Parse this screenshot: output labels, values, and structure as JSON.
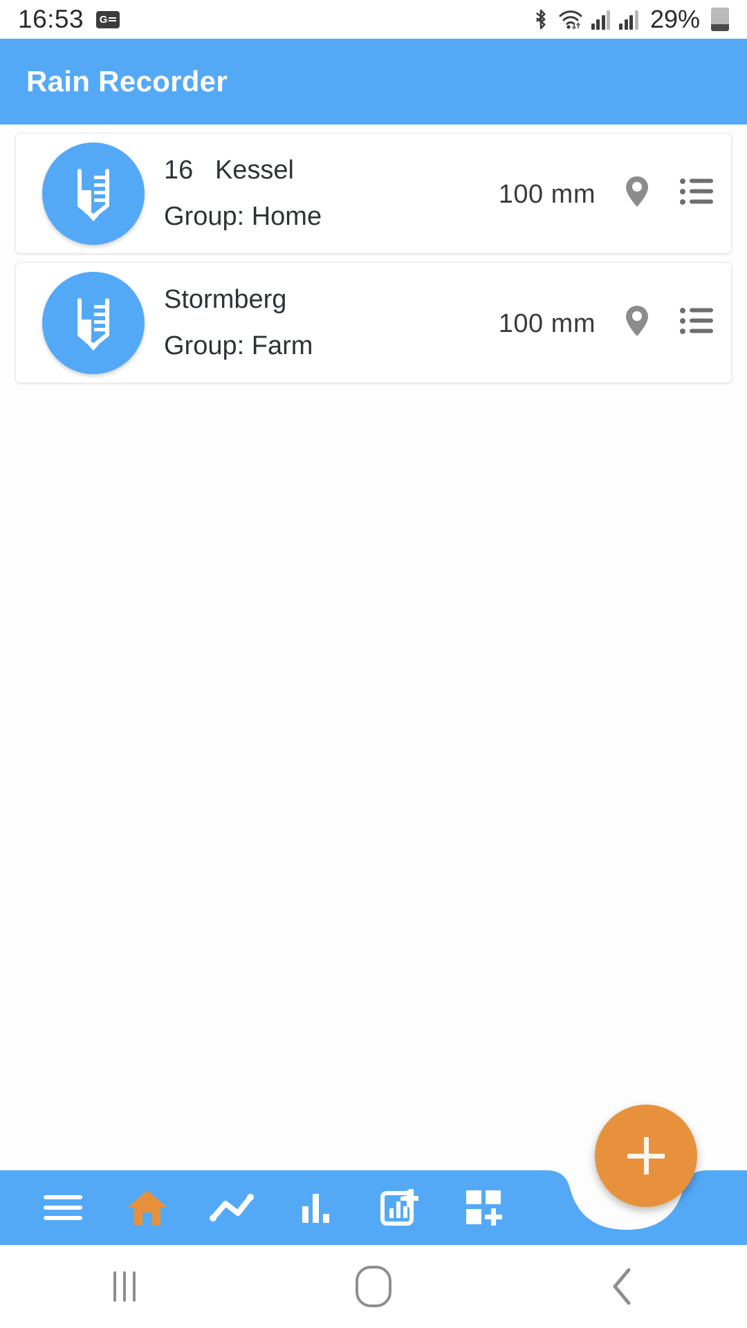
{
  "status_bar": {
    "time": "16:53",
    "battery_percent": "29%",
    "icons": [
      "gpay-card-icon",
      "bluetooth-icon",
      "wifi-icon",
      "signal-sim1-icon",
      "signal-sim2-icon",
      "battery-icon"
    ]
  },
  "app_bar": {
    "title": "Rain Recorder",
    "background_color": "#54a9f7",
    "title_color": "#ffffff"
  },
  "gauges": [
    {
      "name": "16   Kessel",
      "group_label": "Group: Home",
      "capacity": "100 mm",
      "avatar_icon": "rain-gauge-icon",
      "location_icon": "location-pin-icon",
      "list_icon": "list-icon"
    },
    {
      "name": "Stormberg",
      "group_label": "Group: Farm",
      "capacity": "100 mm",
      "avatar_icon": "rain-gauge-icon",
      "location_icon": "location-pin-icon",
      "list_icon": "list-icon"
    }
  ],
  "bottom_nav": {
    "background_color": "#54a9f7",
    "active_color": "#e8913c",
    "items": [
      {
        "name": "menu",
        "icon": "hamburger-menu-icon",
        "active": false
      },
      {
        "name": "home",
        "icon": "home-icon",
        "active": true
      },
      {
        "name": "trend",
        "icon": "line-chart-icon",
        "active": false
      },
      {
        "name": "stats",
        "icon": "bar-chart-icon",
        "active": false
      },
      {
        "name": "add-report",
        "icon": "add-chart-icon",
        "active": false
      },
      {
        "name": "add-group",
        "icon": "grid-plus-icon",
        "active": false
      }
    ]
  },
  "fab": {
    "label": "+",
    "icon": "plus-icon",
    "color": "#e8913c"
  },
  "android_nav": {
    "recents": "recents-icon",
    "home": "home-button-icon",
    "back": "back-icon"
  }
}
